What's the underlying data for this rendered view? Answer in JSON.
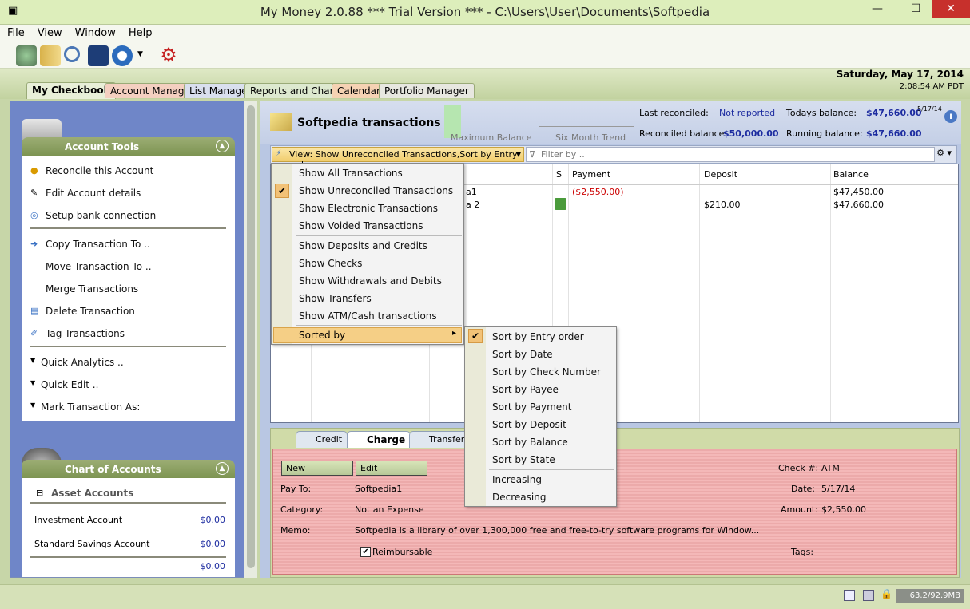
{
  "window": {
    "title": "My Money 2.0.88 *** Trial Version *** - C:\\Users\\User\\Documents\\Softpedia",
    "minimize": "—",
    "maximize": "☐",
    "close": "✕"
  },
  "menu": [
    "File",
    "View",
    "Window",
    "Help"
  ],
  "tabs": [
    "My Checkbook",
    "Account Manager",
    "List Manager",
    "Reports and Charts",
    "Calendar",
    "Portfolio Manager"
  ],
  "date": {
    "day": "Saturday, May 17, 2014",
    "time": "2:08:54 AM PDT"
  },
  "account_tools": {
    "title": "Account Tools",
    "items": [
      "Reconcile this Account",
      "Edit Account details",
      "Setup bank connection",
      "Copy Transaction To ..",
      "Move Transaction To ..",
      "Merge Transactions",
      "Delete Transaction",
      "Tag Transactions",
      "Quick Analytics ..",
      "Quick Edit ..",
      "Mark Transaction As:"
    ]
  },
  "chart_of_accounts": {
    "title": "Chart of Accounts",
    "group": "Asset Accounts",
    "accounts": [
      {
        "name": "Investment Account",
        "amount": "$0.00"
      },
      {
        "name": "Standard Savings Account",
        "amount": "$0.00"
      }
    ],
    "total": "$0.00"
  },
  "header": {
    "title": "Softpedia transactions",
    "max_balance": "Maximum Balance",
    "six_month": "Six Month Trend",
    "last_reconciled_label": "Last reconciled:",
    "last_reconciled": "Not reported",
    "reconciled_balance_label": "Reconciled balance:",
    "reconciled_balance": "$50,000.00",
    "todays_balance_label": "Todays balance:",
    "todays_balance": "$47,660.00",
    "todays_date": "5/17/14",
    "running_balance_label": "Running balance:",
    "running_balance": "$47,660.00"
  },
  "viewbar": {
    "view": "View: Show Unreconciled Transactions,Sort by Entry order",
    "filter_placeholder": "Filter by .."
  },
  "grid": {
    "cols": {
      "s": "S",
      "payment": "Payment",
      "deposit": "Deposit",
      "balance": "Balance"
    },
    "rows": [
      {
        "payee_tail": "a1",
        "payment": "($2,550.00)",
        "deposit": "",
        "balance": "$47,450.00"
      },
      {
        "payee_tail": "a 2",
        "payment": "",
        "deposit": "$210.00",
        "balance": "$47,660.00"
      }
    ]
  },
  "view_menu": {
    "items": [
      "Show All Transactions",
      "Show Unreconciled Transactions",
      "Show Electronic Transactions",
      "Show Voided Transactions",
      "Show Deposits and Credits",
      "Show Checks",
      "Show Withdrawals and Debits",
      "Show Transfers",
      "Show ATM/Cash transactions",
      "Sorted by"
    ],
    "arrow": "▸",
    "check": "✔"
  },
  "sort_menu": {
    "items": [
      "Sort by Entry order",
      "Sort by Date",
      "Sort by Check Number",
      "Sort by Payee",
      "Sort by Payment",
      "Sort by Deposit",
      "Sort by Balance",
      "Sort by State",
      "Increasing",
      "Decreasing"
    ]
  },
  "form": {
    "tabs": [
      "Credit",
      "Charge",
      "Transfer"
    ],
    "new_btn": "New",
    "edit_btn": "Edit",
    "pay_to_label": "Pay To:",
    "pay_to": "Softpedia1",
    "category_label": "Category:",
    "category": "Not an Expense",
    "memo_label": "Memo:",
    "memo": "Softpedia is a library of over 1,300,000 free and free-to-try software programs for Window...",
    "reimbursable": "Reimbursable",
    "check_label": "Check #:",
    "check": "ATM",
    "date_label": "Date:",
    "date": "5/17/14",
    "amount_label": "Amount:",
    "amount": "$2,550.00",
    "tags_label": "Tags:"
  },
  "status": {
    "memory": "63.2/92.9MB"
  }
}
